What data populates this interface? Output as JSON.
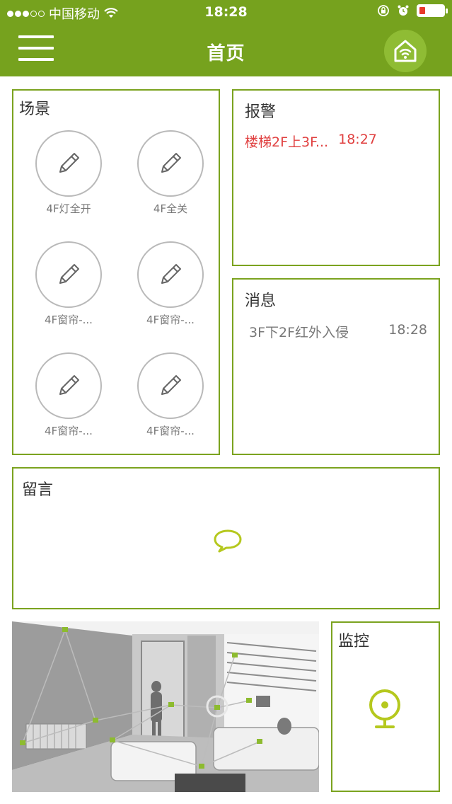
{
  "status_bar": {
    "carrier": "中国移动",
    "time": "18:28"
  },
  "header": {
    "title": "首页",
    "menu_icon": "hamburger-menu-icon",
    "home_icon": "smart-home-wifi-icon",
    "bg_color": "#76a21e"
  },
  "scenes": {
    "title": "场景",
    "items": [
      {
        "label": "4F灯全开",
        "icon": "pencil-icon"
      },
      {
        "label": "4F全关",
        "icon": "pencil-icon"
      },
      {
        "label": "4F窗帘-...",
        "icon": "pencil-icon"
      },
      {
        "label": "4F窗帘-...",
        "icon": "pencil-icon"
      },
      {
        "label": "4F窗帘-...",
        "icon": "pencil-icon"
      },
      {
        "label": "4F窗帘-...",
        "icon": "pencil-icon"
      }
    ]
  },
  "alarm": {
    "title": "报警",
    "items": [
      {
        "text": "楼梯2F上3F...",
        "time": "18:27"
      }
    ],
    "color": "#e04040"
  },
  "messages": {
    "title": "消息",
    "items": [
      {
        "text": "3F下2F红外入侵",
        "time": "18:28"
      }
    ]
  },
  "notes": {
    "title": "留言",
    "icon": "speech-bubble-icon"
  },
  "monitor": {
    "title": "监控",
    "icon": "webcam-icon"
  },
  "accent_color": "#b5c81e"
}
